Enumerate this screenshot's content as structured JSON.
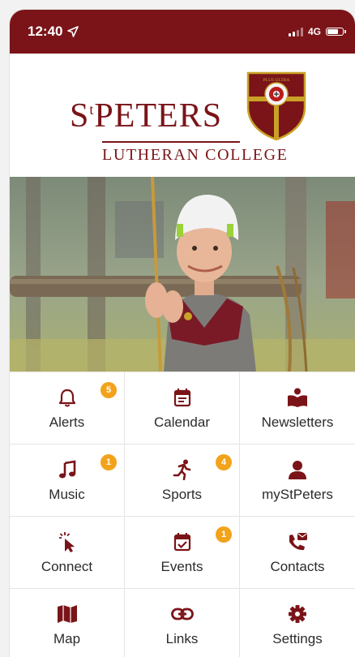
{
  "status_bar": {
    "time": "12:40",
    "network": "4G"
  },
  "logo": {
    "line1_prefix": "S",
    "line1_sup": "t",
    "line1_main": "PETERS",
    "line2": "LUTHERAN COLLEGE",
    "crest_motto": "PLUS ULTRA"
  },
  "colors": {
    "brand": "#7a1418",
    "badge": "#f2a31b"
  },
  "menu": [
    {
      "label": "Alerts",
      "icon": "bell-icon",
      "badge": "5"
    },
    {
      "label": "Calendar",
      "icon": "calendar-icon",
      "badge": ""
    },
    {
      "label": "Newsletters",
      "icon": "book-reader-icon",
      "badge": ""
    },
    {
      "label": "Music",
      "icon": "music-note-icon",
      "badge": "1"
    },
    {
      "label": "Sports",
      "icon": "running-icon",
      "badge": "4"
    },
    {
      "label": "myStPeters",
      "icon": "user-icon",
      "badge": ""
    },
    {
      "label": "Connect",
      "icon": "pointer-click-icon",
      "badge": ""
    },
    {
      "label": "Events",
      "icon": "calendar-check-icon",
      "badge": "1"
    },
    {
      "label": "Contacts",
      "icon": "phone-mail-icon",
      "badge": ""
    },
    {
      "label": "Map",
      "icon": "map-icon",
      "badge": ""
    },
    {
      "label": "Links",
      "icon": "link-icon",
      "badge": ""
    },
    {
      "label": "Settings",
      "icon": "gear-icon",
      "badge": ""
    }
  ]
}
